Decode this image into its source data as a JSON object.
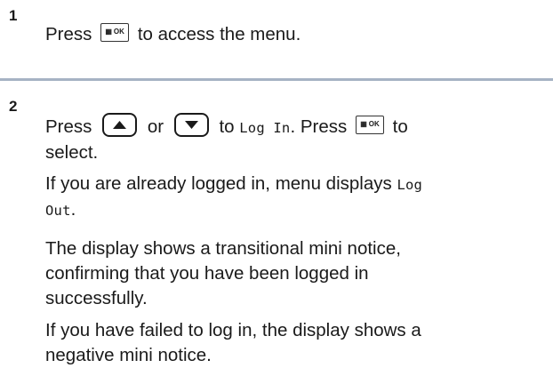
{
  "step1": {
    "number": "1",
    "text_before": "Press",
    "text_after": "to access the menu.",
    "ok_key_label": "OK",
    "ok_key_icon": "menu-grid-icon"
  },
  "step2": {
    "number": "2",
    "line1_press": "Press",
    "line1_or": "or",
    "line1_to": "to",
    "line1_menu_item": "Log In",
    "line1_period": ". Press",
    "line1_to2": "to",
    "line2": "select.",
    "para2_text": "If you are already logged in, menu displays",
    "para2_menu_item_1": "Log",
    "para2_menu_item_2": "Out",
    "para2_end": ".",
    "para3_line1": "The display shows a transitional mini notice,",
    "para3_line2": "confirming that you have been logged in",
    "para3_line3": "successfully.",
    "para4_line1": "If you have failed to log in, the display shows a",
    "para4_line2": "negative mini notice.",
    "up_key_icon": "up-arrow-icon",
    "down_key_icon": "down-arrow-icon",
    "ok_key_label": "OK"
  },
  "colors": {
    "divider": "#a6b3c4",
    "text": "#1a1a1a"
  }
}
